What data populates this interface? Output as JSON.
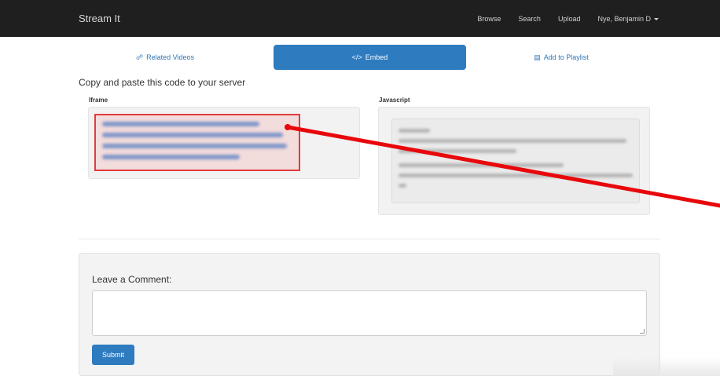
{
  "navbar": {
    "brand": "Stream It",
    "links": [
      "Browse",
      "Search",
      "Upload"
    ],
    "user": "Nye, Benjamin D"
  },
  "tabs": {
    "related": "Related Videos",
    "embed": "Embed",
    "playlist": "Add to Playlist",
    "related_icon": "link-icon",
    "embed_icon": "code-icon",
    "playlist_icon": "list-icon"
  },
  "embed": {
    "heading": "Copy and paste this code to your server",
    "iframe_label": "Iframe",
    "javascript_label": "Javascript"
  },
  "comment": {
    "title": "Leave a Comment:",
    "placeholder": "",
    "submit": "Submit"
  },
  "colors": {
    "accent": "#2e7bc0",
    "highlight": "#e23b3b",
    "arrow": "#e8080b"
  }
}
